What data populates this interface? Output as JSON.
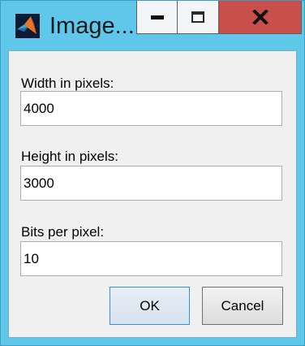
{
  "window": {
    "title": "Image...",
    "app_icon": "matlab-icon",
    "controls": {
      "minimize": "minimize-icon",
      "maximize": "maximize-icon",
      "close": "close-icon"
    }
  },
  "form": {
    "fields": [
      {
        "label": "Width in pixels:",
        "value": "4000"
      },
      {
        "label": "Height in pixels:",
        "value": "3000"
      },
      {
        "label": "Bits per pixel:",
        "value": "10"
      }
    ]
  },
  "buttons": {
    "ok": "OK",
    "cancel": "Cancel"
  },
  "colors": {
    "frame": "#5fc7ea",
    "client": "#f0f0f0",
    "close_button": "#c84f4a",
    "default_button_border": "#3c8dd4"
  }
}
